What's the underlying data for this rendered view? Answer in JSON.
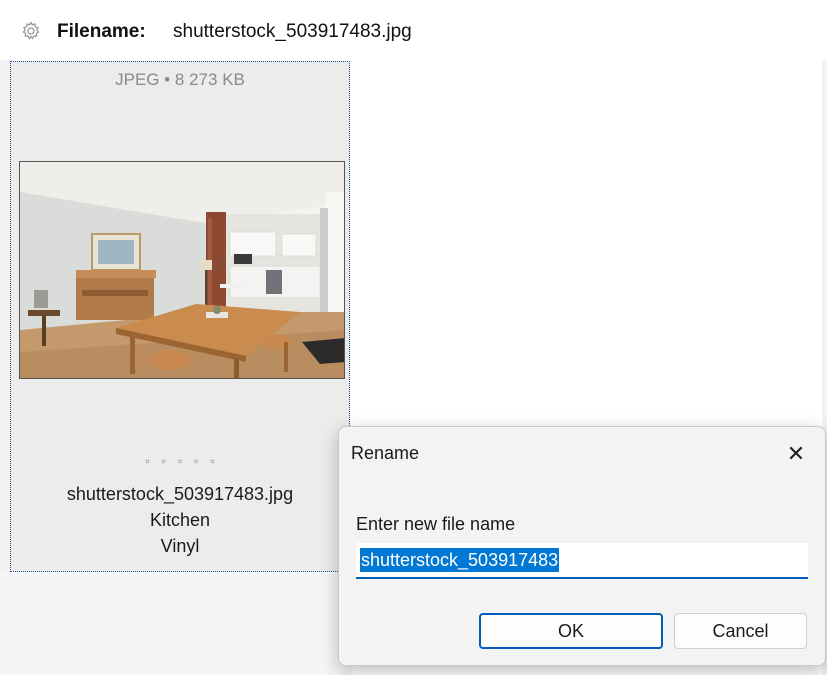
{
  "header": {
    "icon": "gear-icon",
    "label": "Filename:",
    "value": "shutterstock_503917483.jpg"
  },
  "tile": {
    "meta": "JPEG • 8 273 KB",
    "dots": "▫▫▫▫▫",
    "filename": "shutterstock_503917483.jpg",
    "tag1": "Kitchen",
    "tag2": "Vinyl"
  },
  "dialog": {
    "title": "Rename",
    "close_icon": "close-icon",
    "prompt": "Enter new file name",
    "input_value": "shutterstock_503917483",
    "ok_label": "OK",
    "cancel_label": "Cancel"
  },
  "colors": {
    "accent": "#005fb8",
    "selection": "#0078d4",
    "tile_bg": "#ececec",
    "dialog_bg": "#f3f3f3"
  }
}
